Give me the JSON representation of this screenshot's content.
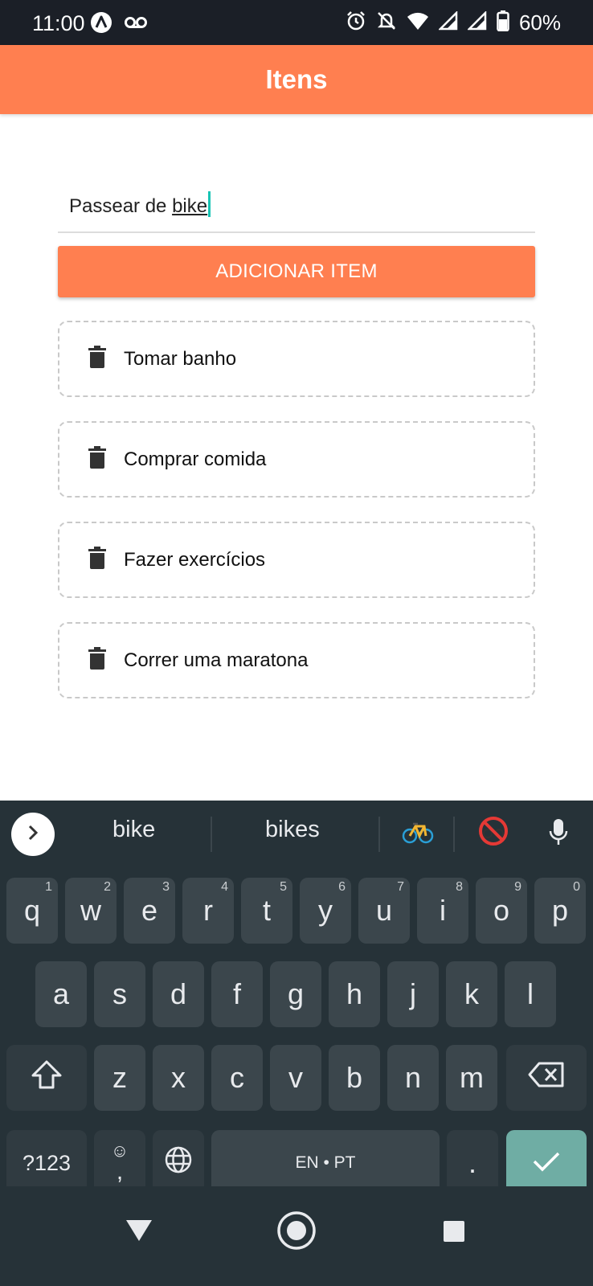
{
  "status_bar": {
    "time": "11:00",
    "battery": "60%",
    "icons": [
      "android-a-icon",
      "voicemail-icon",
      "alarm-icon",
      "bell-off-icon",
      "wifi-icon",
      "signal-icon",
      "signal-icon",
      "battery-icon"
    ]
  },
  "header": {
    "title": "Itens"
  },
  "input": {
    "value_prefix": "Passear de ",
    "value_word": "bike"
  },
  "add_button": {
    "label": "ADICIONAR ITEM"
  },
  "items": [
    {
      "label": "Tomar banho"
    },
    {
      "label": "Comprar comida"
    },
    {
      "label": "Fazer exercícios"
    },
    {
      "label": "Correr uma maratona"
    }
  ],
  "keyboard": {
    "suggestions": [
      "bike",
      "bikes"
    ],
    "row1": [
      {
        "k": "q",
        "h": "1"
      },
      {
        "k": "w",
        "h": "2"
      },
      {
        "k": "e",
        "h": "3"
      },
      {
        "k": "r",
        "h": "4"
      },
      {
        "k": "t",
        "h": "5"
      },
      {
        "k": "y",
        "h": "6"
      },
      {
        "k": "u",
        "h": "7"
      },
      {
        "k": "i",
        "h": "8"
      },
      {
        "k": "o",
        "h": "9"
      },
      {
        "k": "p",
        "h": "0"
      }
    ],
    "row2": [
      "a",
      "s",
      "d",
      "f",
      "g",
      "h",
      "j",
      "k",
      "l"
    ],
    "row3": [
      "z",
      "x",
      "c",
      "v",
      "b",
      "n",
      "m"
    ],
    "symbols_label": "?123",
    "comma_label": ",",
    "space_label": "EN • PT",
    "period_label": ".",
    "colors": {
      "accent": "#ff7f50",
      "enter": "#6fada4",
      "keyboard_bg": "#263238"
    }
  }
}
